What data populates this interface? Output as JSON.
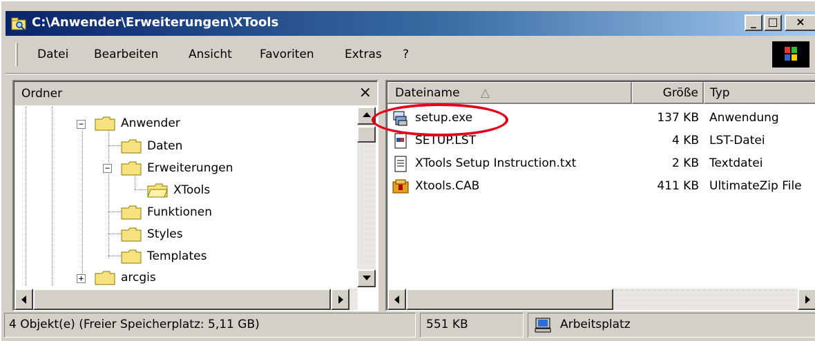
{
  "window": {
    "title": "C:\\Anwender\\Erweiterungen\\XTools",
    "controls": {
      "minimize": "_",
      "maximize": "□",
      "close": "×"
    }
  },
  "menu": {
    "items": [
      {
        "label": "Datei",
        "accel": "D"
      },
      {
        "label": "Bearbeiten",
        "accel": "B"
      },
      {
        "label": "Ansicht",
        "accel": "A"
      },
      {
        "label": "Favoriten",
        "accel": "F"
      },
      {
        "label": "Extras",
        "accel": "t"
      },
      {
        "label": "?",
        "accel": "?"
      }
    ]
  },
  "folders_pane": {
    "title": "Ordner",
    "close_label": "×",
    "tree": [
      {
        "label": "Anwender",
        "expander": "−"
      },
      {
        "label": "Daten"
      },
      {
        "label": "Erweiterungen",
        "expander": "−"
      },
      {
        "label": "XTools",
        "selected": true
      },
      {
        "label": "Funktionen"
      },
      {
        "label": "Styles"
      },
      {
        "label": "Templates"
      },
      {
        "label": "arcgis",
        "expander": "+"
      }
    ]
  },
  "file_list": {
    "columns": {
      "name": "Dateiname",
      "size": "Größe",
      "type": "Typ"
    },
    "sort_indicator": "△",
    "rows": [
      {
        "name": "setup.exe",
        "size": "137 KB",
        "type": "Anwendung",
        "icon": "setup-exe-icon"
      },
      {
        "name": "SETUP.LST",
        "size": "4 KB",
        "type": "LST-Datei",
        "icon": "lst-file-icon"
      },
      {
        "name": "XTools Setup Instruction.txt",
        "size": "2 KB",
        "type": "Textdatei",
        "icon": "text-file-icon"
      },
      {
        "name": "Xtools.CAB",
        "size": "411 KB",
        "type": "UltimateZip File",
        "icon": "cab-archive-icon"
      }
    ]
  },
  "statusbar": {
    "objects": "4 Objekt(e)  (Freier Speicherplatz: 5,11 GB)",
    "size": "551 KB",
    "location": "Arbeitsplatz"
  },
  "colors": {
    "title_gradient_start": "#0a246a",
    "title_gradient_end": "#a6caf0",
    "highlight_ring": "#e3001b",
    "folder_yellow": "#f6e27e"
  }
}
